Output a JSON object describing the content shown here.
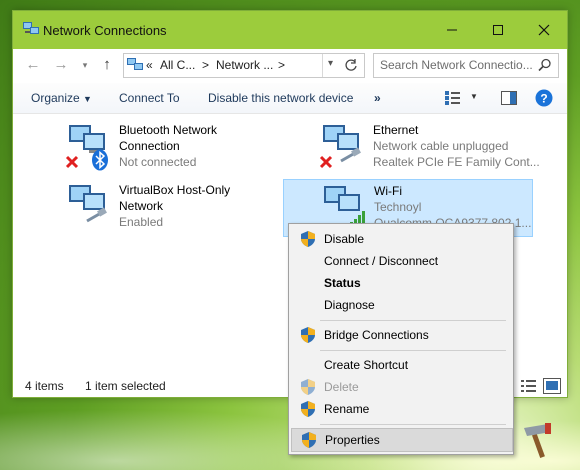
{
  "window": {
    "title": "Network Connections",
    "controls": [
      "minimize",
      "maximize",
      "close"
    ]
  },
  "address_bar": {
    "segments": [
      "«",
      "All C...",
      ">",
      "Network ...",
      ">"
    ],
    "search_placeholder": "Search Network Connectio..."
  },
  "toolbar": {
    "organize": "Organize",
    "connect_to": "Connect To",
    "disable_device": "Disable this network device",
    "more": "»"
  },
  "connections": [
    {
      "name": "Bluetooth Network",
      "name2": "Connection",
      "status": "Not connected",
      "device": "",
      "badge": "bluetooth-icon",
      "error": true,
      "selected": false
    },
    {
      "name": "Ethernet",
      "name2": "",
      "status": "Network cable unplugged",
      "device": "Realtek PCIe FE Family Cont...",
      "badge": "cable-icon",
      "error": true,
      "selected": false
    },
    {
      "name": "VirtualBox Host-Only",
      "name2": "Network",
      "status": "Enabled",
      "device": "",
      "badge": "cable-icon",
      "error": false,
      "selected": false
    },
    {
      "name": "Wi-Fi",
      "name2": "",
      "status": "Technoyl",
      "device": "Qualcomm QCA9377 802.1...",
      "badge": "wifi-bars-icon",
      "error": false,
      "selected": true
    }
  ],
  "statusbar": {
    "items_count": "4 items",
    "selected_count": "1 item selected"
  },
  "context_menu": [
    {
      "label": "Disable",
      "shield": true,
      "disabled": false,
      "bold": false
    },
    {
      "label": "Connect / Disconnect",
      "shield": false,
      "disabled": false,
      "bold": false
    },
    {
      "label": "Status",
      "shield": false,
      "disabled": false,
      "bold": true
    },
    {
      "label": "Diagnose",
      "shield": false,
      "disabled": false,
      "bold": false
    },
    {
      "label": "Bridge Connections",
      "shield": true,
      "disabled": false,
      "bold": false
    },
    {
      "label": "Create Shortcut",
      "shield": false,
      "disabled": false,
      "bold": false
    },
    {
      "label": "Delete",
      "shield": true,
      "disabled": true,
      "bold": false
    },
    {
      "label": "Rename",
      "shield": true,
      "disabled": false,
      "bold": false
    },
    {
      "label": "Properties",
      "shield": true,
      "disabled": false,
      "bold": false,
      "highlighted": true
    }
  ],
  "colors": {
    "titlebar": "#9ccc3c",
    "selection": "#cce8ff",
    "help": "#1a73d9"
  }
}
